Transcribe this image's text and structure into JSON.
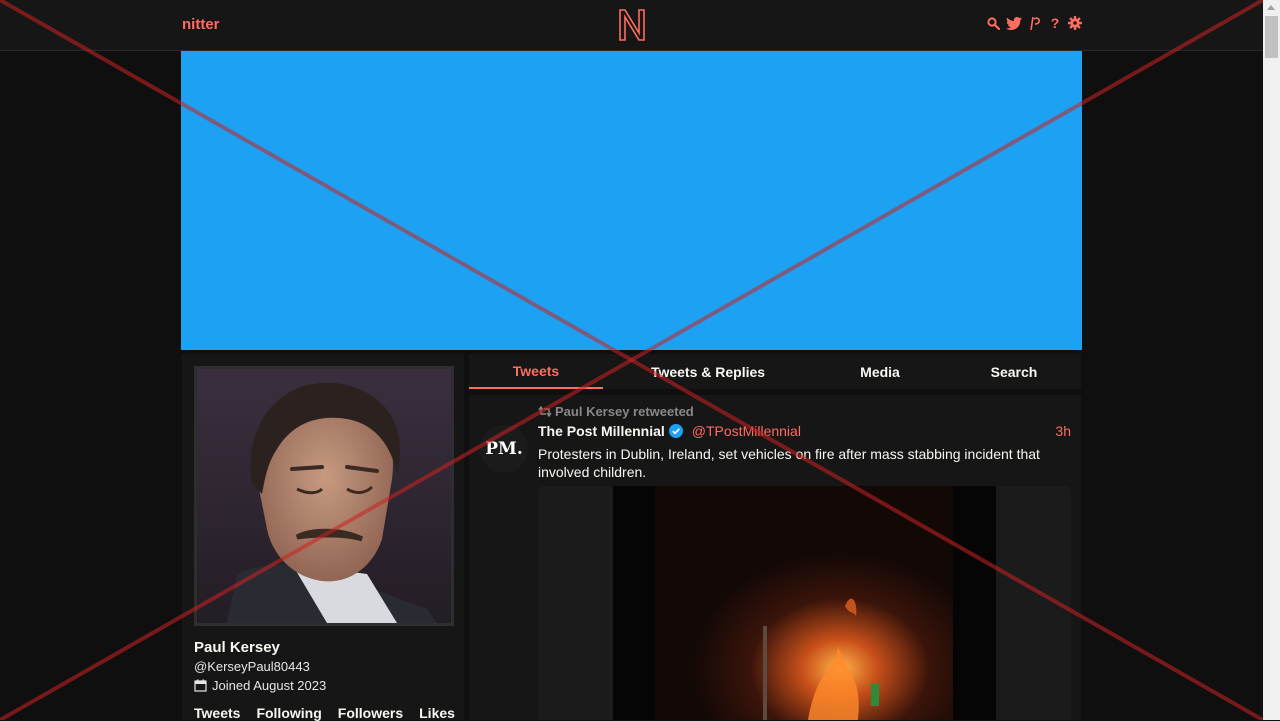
{
  "nav": {
    "brand": "nitter",
    "icons": [
      "search-icon",
      "twitter-bird-icon",
      "rss-icon",
      "help-icon",
      "settings-gear-icon"
    ],
    "help_glyph": "?"
  },
  "banner": {
    "color": "#1da1f2"
  },
  "profile": {
    "fullname": "Paul Kersey",
    "username": "@KerseyPaul80443",
    "joined": "Joined August 2023",
    "stats": {
      "tweets": "Tweets",
      "following": "Following",
      "followers": "Followers",
      "likes": "Likes"
    }
  },
  "tabs": [
    {
      "label": "Tweets",
      "active": true
    },
    {
      "label": "Tweets & Replies",
      "active": false
    },
    {
      "label": "Media",
      "active": false
    },
    {
      "label": "Search",
      "active": false
    }
  ],
  "tweet": {
    "retweet_label": "Paul Kersey retweeted",
    "avatar_text": "PM.",
    "fullname": "The Post Millennial",
    "verified": true,
    "username": "@TPostMillennial",
    "date": "3h",
    "text": "Protesters in Dublin, Ireland, set vehicles on fire after mass stabbing incident that involved children."
  },
  "colors": {
    "accent": "#ff6c60",
    "background": "#0f0f0f",
    "panel": "#161616"
  }
}
